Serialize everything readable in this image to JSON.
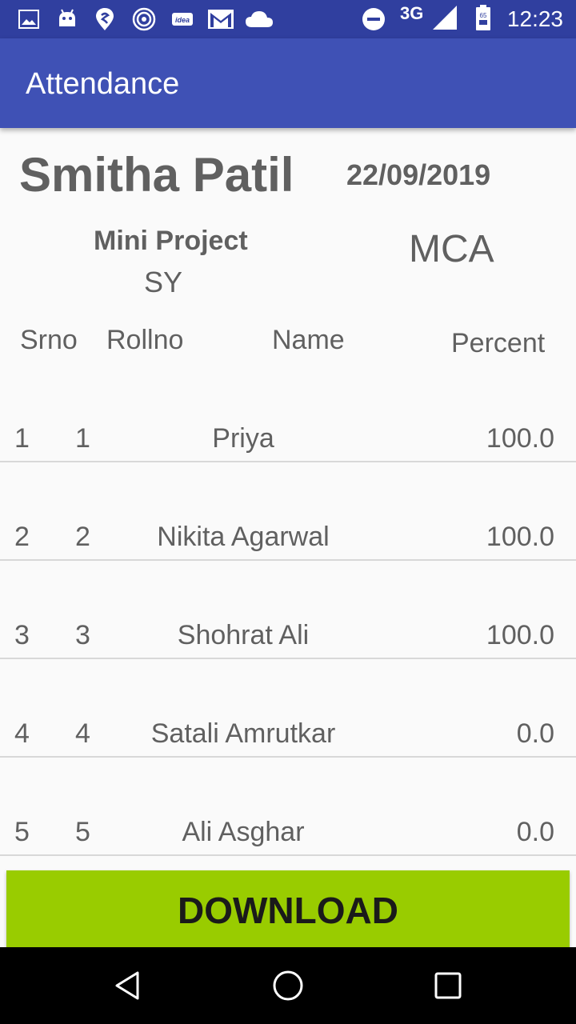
{
  "status_bar": {
    "time": "12:23",
    "network": "3G",
    "battery_level": "65",
    "icons": [
      "image-icon",
      "android-icon",
      "swiggy-icon",
      "jio-icon",
      "idea-icon",
      "gmail-icon",
      "cloud-icon",
      "dnd-icon",
      "signal-icon",
      "battery-icon"
    ],
    "idea_label": "idea"
  },
  "app_bar": {
    "title": "Attendance"
  },
  "header": {
    "teacher_name": "Smitha Patil",
    "date": "22/09/2019",
    "subject": "Mini Project",
    "year": "SY",
    "course": "MCA"
  },
  "table": {
    "columns": {
      "srno": "Srno",
      "rollno": "Rollno",
      "name": "Name",
      "percent": "Percent"
    },
    "rows": [
      {
        "srno": "1",
        "rollno": "1",
        "name": "Priya",
        "percent": "100.0"
      },
      {
        "srno": "2",
        "rollno": "2",
        "name": "Nikita Agarwal",
        "percent": "100.0"
      },
      {
        "srno": "3",
        "rollno": "3",
        "name": "Shohrat Ali",
        "percent": "100.0"
      },
      {
        "srno": "4",
        "rollno": "4",
        "name": "Satali Amrutkar",
        "percent": "0.0"
      },
      {
        "srno": "5",
        "rollno": "5",
        "name": "Ali Asghar",
        "percent": "0.0"
      }
    ]
  },
  "actions": {
    "download_label": "DOWNLOAD"
  },
  "colors": {
    "status_bar": "#303f9f",
    "app_bar": "#3f51b5",
    "download_button": "#99cc00",
    "text": "#606060"
  }
}
